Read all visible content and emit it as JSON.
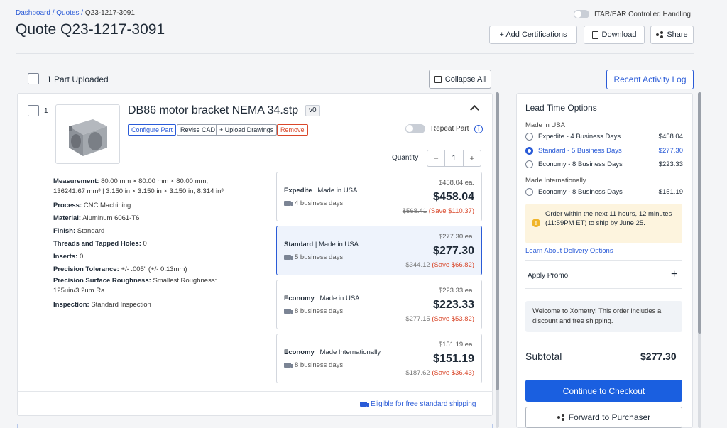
{
  "breadcrumb": {
    "dashboard": "Dashboard",
    "quotes": "Quotes",
    "current": "Q23-1217-3091",
    "sep": " / "
  },
  "page_title": "Quote Q23-1217-3091",
  "itar_label": "ITAR/EAR Controlled Handling",
  "header_buttons": {
    "certifications": "+ Add Certifications",
    "download": "Download",
    "share": "Share"
  },
  "parts_header": {
    "count_label": "1 Part Uploaded",
    "collapse": "Collapse All",
    "activity_log": "Recent Activity Log"
  },
  "part": {
    "index": "1",
    "name": "DB86 motor bracket NEMA 34.stp",
    "version": "v0",
    "tags": {
      "configure": "Configure Part",
      "revise": "Revise CAD",
      "upload": "+ Upload Drawings",
      "remove": "Remove"
    },
    "repeat_label": "Repeat Part",
    "quantity_label": "Quantity",
    "quantity": "1",
    "specs": [
      {
        "k": "Measurement:",
        "v": "80.00 mm × 80.00 mm × 80.00 mm, 136241.67 mm³  |  3.150 in × 3.150 in × 3.150 in, 8.314 in³"
      },
      {
        "k": "Process:",
        "v": "CNC Machining"
      },
      {
        "k": "Material:",
        "v": "Aluminum 6061-T6"
      },
      {
        "k": "Finish:",
        "v": "Standard"
      },
      {
        "k": "Threads and Tapped Holes:",
        "v": "0"
      },
      {
        "k": "Inserts:",
        "v": "0"
      },
      {
        "k": "Precision Tolerance:",
        "v": "+/- .005\" (+/- 0.13mm)"
      },
      {
        "k": "Precision Surface Roughness:",
        "v": "Smallest Roughness: 125uin/3.2um Ra"
      },
      {
        "k": "Inspection:",
        "v": "Standard Inspection"
      }
    ],
    "options": [
      {
        "tier": "Expedite",
        "origin": "Made in USA",
        "days": "4 business days",
        "each": "$458.04 ea.",
        "price": "$458.04",
        "original": "$568.41",
        "save": "(Save $110.37)"
      },
      {
        "tier": "Standard",
        "origin": "Made in USA",
        "days": "5 business days",
        "each": "$277.30 ea.",
        "price": "$277.30",
        "original": "$344.12",
        "save": "(Save $66.82)"
      },
      {
        "tier": "Economy",
        "origin": "Made in USA",
        "days": "8 business days",
        "each": "$223.33 ea.",
        "price": "$223.33",
        "original": "$277.15",
        "save": "(Save $53.82)"
      },
      {
        "tier": "Economy",
        "origin": "Made Internationally",
        "days": "8 business days",
        "each": "$151.19 ea.",
        "price": "$151.19",
        "original": "$187.62",
        "save": "(Save $36.43)"
      }
    ],
    "free_shipping": "Eligible for free standard shipping"
  },
  "lead_time": {
    "title": "Lead Time Options",
    "group_usa": "Made in USA",
    "group_intl": "Made Internationally",
    "rows": [
      {
        "label": "Expedite - 4 Business Days",
        "price": "$458.04"
      },
      {
        "label": "Standard - 5 Business Days",
        "price": "$277.30"
      },
      {
        "label": "Economy - 8 Business Days",
        "price": "$223.33"
      },
      {
        "label": "Economy - 8 Business Days",
        "price": "$151.19"
      }
    ],
    "selected_index": 1,
    "notice": "Order within the next 11 hours, 12 minutes (11:59PM ET) to ship by June 25.",
    "learn_link": "Learn About Delivery Options",
    "promo": "Apply Promo",
    "welcome": "Welcome to Xometry! This order includes a discount and free shipping.",
    "subtotal_label": "Subtotal",
    "subtotal_value": "$277.30",
    "checkout": "Continue to Checkout",
    "forward": "Forward to Purchaser"
  },
  "colors": {
    "accent": "#1a5fe0",
    "link": "#2a5bd7",
    "save": "#d9472a",
    "notice_bg": "#fdf4de"
  }
}
